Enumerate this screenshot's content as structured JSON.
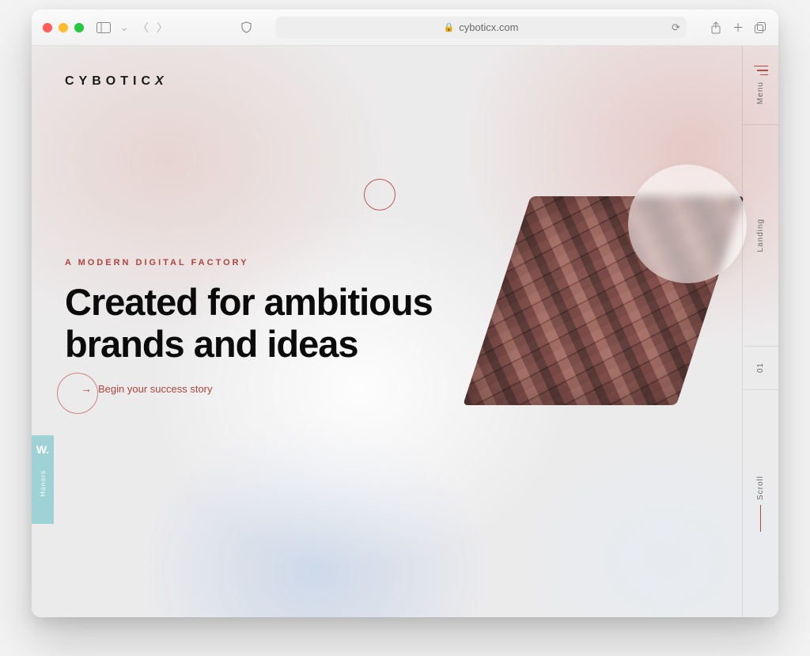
{
  "browser": {
    "url_host": "cyboticx.com"
  },
  "site": {
    "logo_text": "CYBOTIC",
    "logo_x": "X"
  },
  "hero": {
    "eyebrow": "A MODERN DIGITAL FACTORY",
    "headline": "Created for ambitious brands and ideas",
    "cta_label": "Begin your success story"
  },
  "rail": {
    "menu_label": "Menu",
    "section_label": "Landing",
    "index_label": "01",
    "scroll_label": "Scroll"
  },
  "honors": {
    "badge_letter": "W.",
    "badge_label": "Honors"
  }
}
